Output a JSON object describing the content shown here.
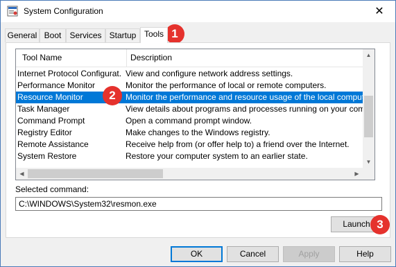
{
  "window": {
    "title": "System Configuration",
    "close_glyph": "✕"
  },
  "tabs": [
    {
      "label": "General"
    },
    {
      "label": "Boot"
    },
    {
      "label": "Services"
    },
    {
      "label": "Startup"
    },
    {
      "label": "Tools"
    }
  ],
  "list": {
    "headers": {
      "name": "Tool Name",
      "description": "Description"
    },
    "rows": [
      {
        "name": "Internet Protocol Configurat...",
        "description": "View and configure network address settings."
      },
      {
        "name": "Performance Monitor",
        "description": "Monitor the performance of local or remote computers."
      },
      {
        "name": "Resource Monitor",
        "description": "Monitor the performance and resource usage of the local computer.",
        "selected": true
      },
      {
        "name": "Task Manager",
        "description": "View details about programs and processes running on your computer."
      },
      {
        "name": "Command Prompt",
        "description": "Open a command prompt window."
      },
      {
        "name": "Registry Editor",
        "description": "Make changes to the Windows registry."
      },
      {
        "name": "Remote Assistance",
        "description": "Receive help from (or offer help to) a friend over the Internet."
      },
      {
        "name": "System Restore",
        "description": "Restore your computer system to an earlier state."
      }
    ]
  },
  "selected_command": {
    "label": "Selected command:",
    "value": "C:\\WINDOWS\\System32\\resmon.exe"
  },
  "buttons": {
    "launch": "Launch",
    "ok": "OK",
    "cancel": "Cancel",
    "apply": "Apply",
    "help": "Help"
  },
  "badges": {
    "tools": "1",
    "row": "2",
    "launch": "3"
  },
  "colors": {
    "selection": "#0078d7",
    "badge": "#e5322d"
  }
}
